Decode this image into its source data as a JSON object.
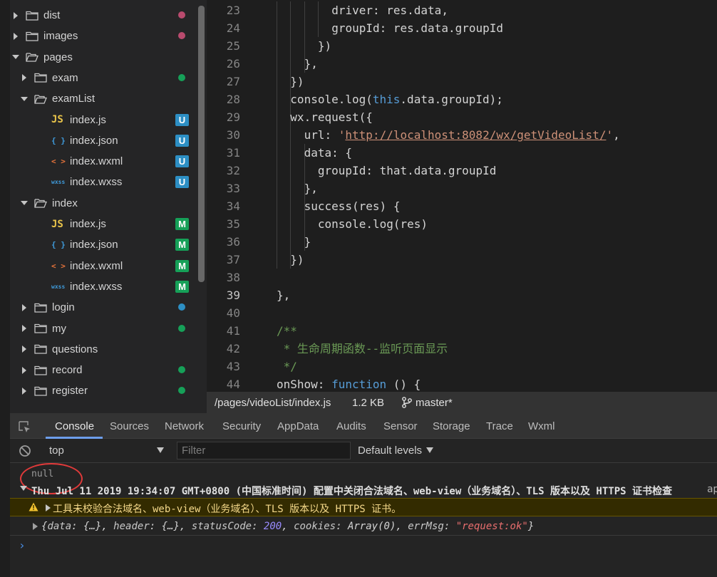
{
  "sidebar": {
    "items": [
      {
        "label": "dist",
        "kind": "folder",
        "state": "collapsed",
        "indent": 0,
        "status": "dot",
        "status_color": "#b94b6e"
      },
      {
        "label": "images",
        "kind": "folder",
        "state": "collapsed",
        "indent": 0,
        "status": "dot",
        "status_color": "#b94b6e"
      },
      {
        "label": "pages",
        "kind": "folder",
        "state": "expanded",
        "indent": 0,
        "status": "none",
        "status_color": ""
      },
      {
        "label": "exam",
        "kind": "folder",
        "state": "collapsed",
        "indent": 1,
        "status": "dot",
        "status_color": "#16a058"
      },
      {
        "label": "examList",
        "kind": "folder",
        "state": "expanded",
        "indent": 1,
        "status": "none",
        "status_color": ""
      },
      {
        "label": "index.js",
        "kind": "js",
        "indent": 2,
        "status": "badge",
        "badge": "U",
        "status_color": "#2d8fc4"
      },
      {
        "label": "index.json",
        "kind": "json",
        "indent": 2,
        "status": "badge",
        "badge": "U",
        "status_color": "#2d8fc4"
      },
      {
        "label": "index.wxml",
        "kind": "wxml",
        "indent": 2,
        "status": "badge",
        "badge": "U",
        "status_color": "#2d8fc4"
      },
      {
        "label": "index.wxss",
        "kind": "wxss",
        "indent": 2,
        "status": "badge",
        "badge": "U",
        "status_color": "#2d8fc4"
      },
      {
        "label": "index",
        "kind": "folder",
        "state": "expanded",
        "indent": 1,
        "status": "none",
        "status_color": ""
      },
      {
        "label": "index.js",
        "kind": "js",
        "indent": 2,
        "status": "badge",
        "badge": "M",
        "status_color": "#16a058"
      },
      {
        "label": "index.json",
        "kind": "json",
        "indent": 2,
        "status": "badge",
        "badge": "M",
        "status_color": "#16a058"
      },
      {
        "label": "index.wxml",
        "kind": "wxml",
        "indent": 2,
        "status": "badge",
        "badge": "M",
        "status_color": "#16a058"
      },
      {
        "label": "index.wxss",
        "kind": "wxss",
        "indent": 2,
        "status": "badge",
        "badge": "M",
        "status_color": "#16a058"
      },
      {
        "label": "login",
        "kind": "folder",
        "state": "collapsed",
        "indent": 1,
        "status": "dot",
        "status_color": "#2d8fc4"
      },
      {
        "label": "my",
        "kind": "folder",
        "state": "collapsed",
        "indent": 1,
        "status": "dot",
        "status_color": "#16a058"
      },
      {
        "label": "questions",
        "kind": "folder",
        "state": "collapsed",
        "indent": 1,
        "status": "none",
        "status_color": ""
      },
      {
        "label": "record",
        "kind": "folder",
        "state": "collapsed",
        "indent": 1,
        "status": "dot",
        "status_color": "#16a058"
      },
      {
        "label": "register",
        "kind": "folder",
        "state": "collapsed",
        "indent": 1,
        "status": "dot",
        "status_color": "#16a058"
      }
    ],
    "file_icons": {
      "js": "JS",
      "json": "{ }",
      "wxml": "< >",
      "wxss": "wxss"
    },
    "file_icon_colors": {
      "js": "#e8c34a",
      "json": "#3f9bdb",
      "wxml": "#e8743b",
      "wxss": "#3f9bdb"
    }
  },
  "editor": {
    "active_line": 39,
    "lines": [
      {
        "n": "23",
        "indent": 4,
        "tokens": [
          [
            "prop",
            "driver: res.data,"
          ]
        ]
      },
      {
        "n": "24",
        "indent": 4,
        "tokens": [
          [
            "prop",
            "groupId: res.data.groupId"
          ]
        ]
      },
      {
        "n": "25",
        "indent": 3,
        "tokens": [
          [
            "prop",
            "})"
          ]
        ]
      },
      {
        "n": "26",
        "indent": 2,
        "tokens": [
          [
            "prop",
            "},"
          ]
        ]
      },
      {
        "n": "27",
        "indent": 1,
        "tokens": [
          [
            "prop",
            "})"
          ]
        ]
      },
      {
        "n": "28",
        "indent": 1,
        "tokens": [
          [
            "prop",
            "console.log("
          ],
          [
            "this",
            "this"
          ],
          [
            "prop",
            ".data.groupId);"
          ]
        ]
      },
      {
        "n": "29",
        "indent": 1,
        "tokens": [
          [
            "prop",
            "wx.request({"
          ]
        ]
      },
      {
        "n": "30",
        "indent": 2,
        "tokens": [
          [
            "prop",
            "url: "
          ],
          [
            "str",
            "'"
          ],
          [
            "url",
            "http://localhost:8082/wx/getVideoList/"
          ],
          [
            "str",
            "'"
          ],
          [
            "prop",
            ","
          ]
        ]
      },
      {
        "n": "31",
        "indent": 2,
        "tokens": [
          [
            "prop",
            "data: {"
          ]
        ]
      },
      {
        "n": "32",
        "indent": 3,
        "tokens": [
          [
            "prop",
            "groupId: that.data.groupId"
          ]
        ]
      },
      {
        "n": "33",
        "indent": 2,
        "tokens": [
          [
            "prop",
            "},"
          ]
        ]
      },
      {
        "n": "34",
        "indent": 2,
        "tokens": [
          [
            "prop",
            "success(res) {"
          ]
        ]
      },
      {
        "n": "35",
        "indent": 3,
        "tokens": [
          [
            "prop",
            "console.log(res)"
          ]
        ]
      },
      {
        "n": "36",
        "indent": 2,
        "tokens": [
          [
            "prop",
            "}"
          ]
        ]
      },
      {
        "n": "37",
        "indent": 1,
        "tokens": [
          [
            "prop",
            "})"
          ]
        ]
      },
      {
        "n": "38",
        "indent": 0,
        "tokens": []
      },
      {
        "n": "39",
        "indent": 0,
        "tokens": [
          [
            "prop",
            "},"
          ]
        ]
      },
      {
        "n": "40",
        "indent": 0,
        "tokens": []
      },
      {
        "n": "41",
        "indent": 0,
        "tokens": [
          [
            "com",
            "/**"
          ]
        ]
      },
      {
        "n": "42",
        "indent": 0,
        "tokens": [
          [
            "com",
            " * 生命周期函数--监听页面显示"
          ]
        ]
      },
      {
        "n": "43",
        "indent": 0,
        "tokens": [
          [
            "com",
            " */"
          ]
        ]
      },
      {
        "n": "44",
        "indent": 0,
        "tokens": [
          [
            "prop",
            "onShow: "
          ],
          [
            "kw",
            "function"
          ],
          [
            "prop",
            " () {"
          ]
        ]
      }
    ]
  },
  "statusbar": {
    "path": "/pages/videoList/index.js",
    "size": "1.2 KB",
    "branch": "master*",
    "branch_icon": "git-branch-icon"
  },
  "devtools": {
    "tabs": [
      "Console",
      "Sources",
      "Network",
      "Security",
      "AppData",
      "Audits",
      "Sensor",
      "Storage",
      "Trace",
      "Wxml"
    ],
    "active_tab": "Console",
    "context": "top",
    "filter_placeholder": "Filter",
    "levels": "Default levels",
    "console": {
      "null_log": "null",
      "group_text": "Thu Jul 11 2019 19:34:07 GMT+0800 (中国标准时间) 配置中关闭合法域名、web-view（业务域名）、TLS 版本以及 HTTPS 证书检查",
      "group_source": "ap",
      "warning_text": "工具未校验合法域名、web-view（业务域名）、TLS 版本以及 HTTPS 证书。",
      "object": {
        "open": "{",
        "data_key": "data",
        "data_val": "{…}",
        "header_key": "header",
        "header_val": "{…}",
        "status_key": "statusCode",
        "status_val": "200",
        "cookies_key": "cookies",
        "cookies_val": "Array(0)",
        "errmsg_key": "errMsg",
        "errmsg_val": "\"request:ok\"",
        "close": "}"
      },
      "prompt": "›"
    }
  }
}
